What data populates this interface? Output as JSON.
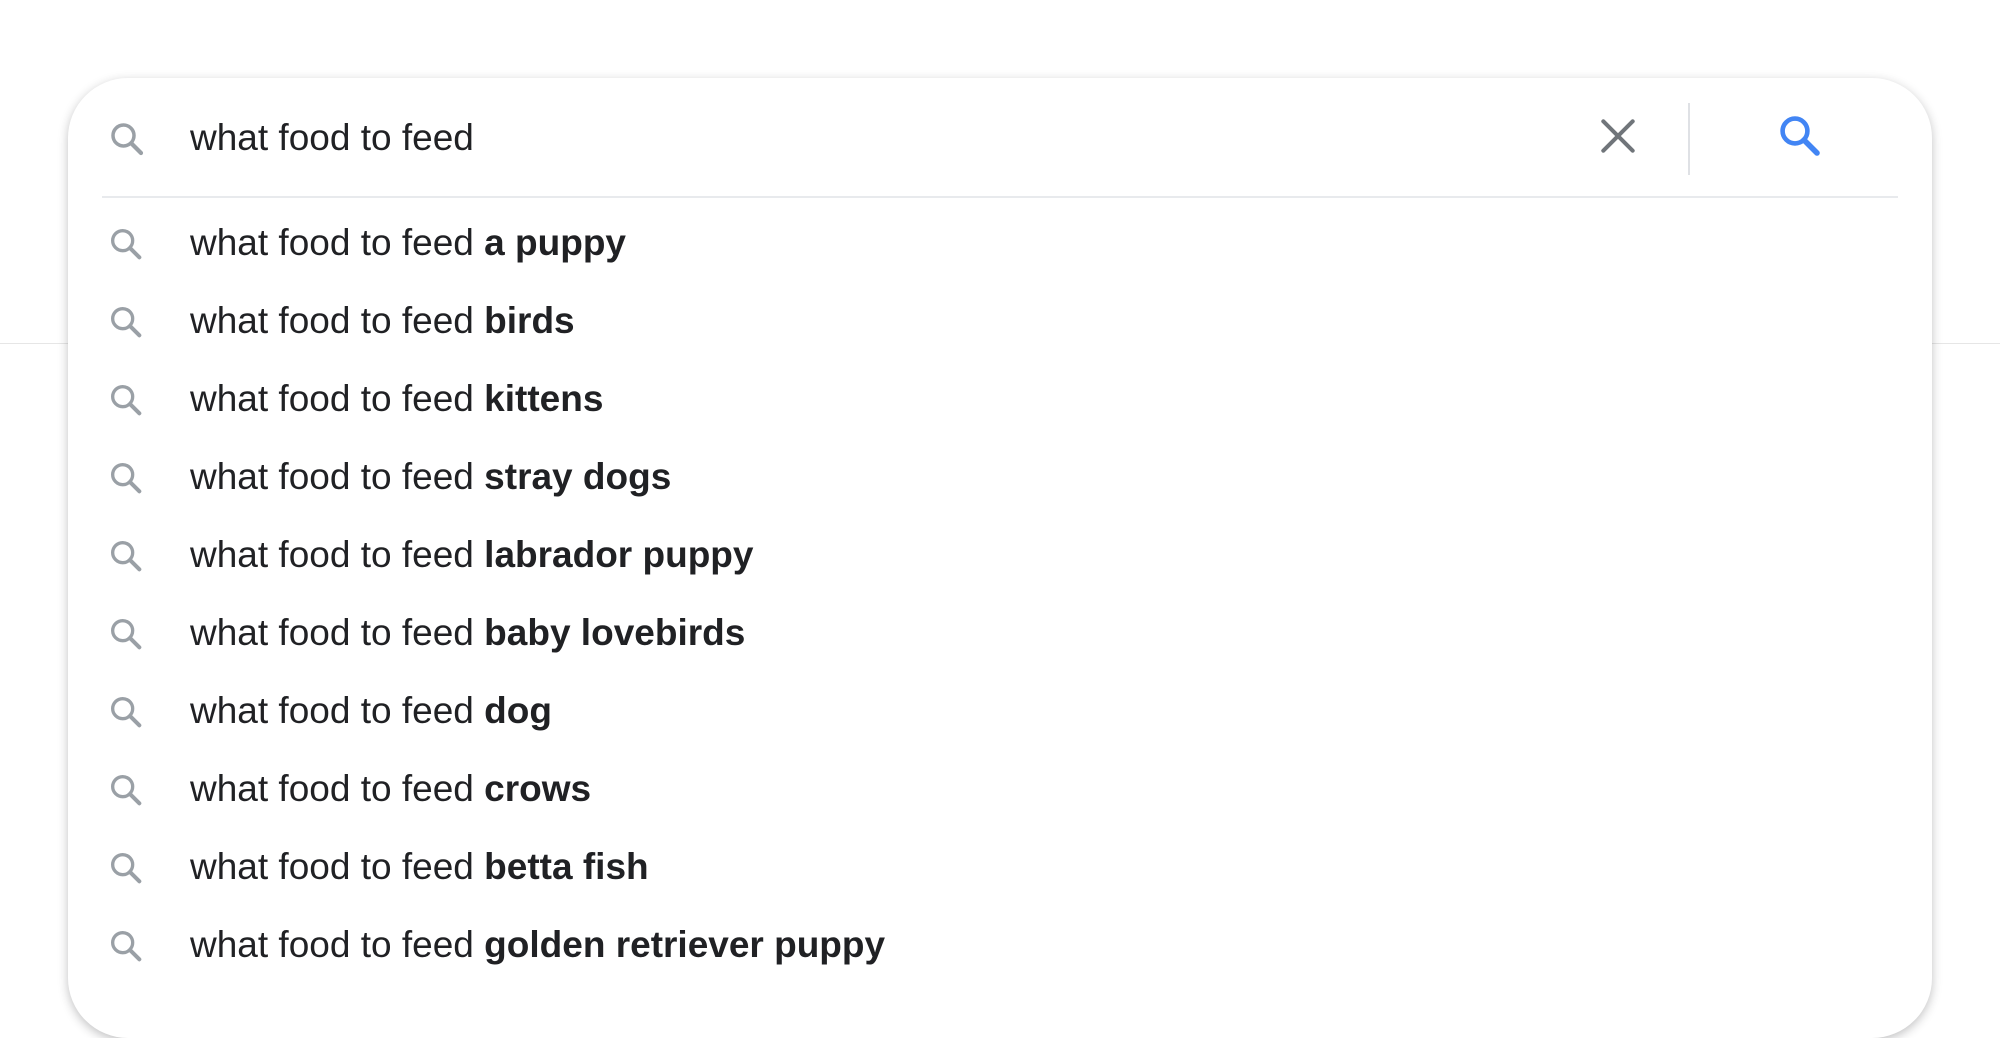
{
  "search": {
    "query": "what food to feed",
    "clear_icon": "close-icon",
    "submit_icon": "search-icon",
    "accent_color": "#4285f4"
  },
  "suggestions": [
    {
      "prefix": "what food to feed",
      "completion": "a puppy"
    },
    {
      "prefix": "what food to feed",
      "completion": "birds"
    },
    {
      "prefix": "what food to feed",
      "completion": "kittens"
    },
    {
      "prefix": "what food to feed",
      "completion": "stray dogs"
    },
    {
      "prefix": "what food to feed",
      "completion": "labrador puppy"
    },
    {
      "prefix": "what food to feed",
      "completion": "baby lovebirds"
    },
    {
      "prefix": "what food to feed",
      "completion": "dog"
    },
    {
      "prefix": "what food to feed",
      "completion": "crows"
    },
    {
      "prefix": "what food to feed",
      "completion": "betta fish"
    },
    {
      "prefix": "what food to feed",
      "completion": "golden retriever puppy"
    }
  ]
}
